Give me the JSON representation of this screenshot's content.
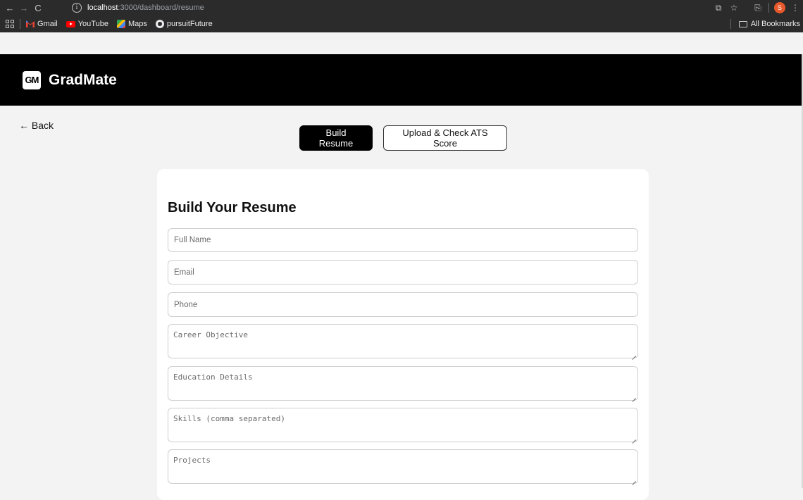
{
  "browser": {
    "url_host": "localhost",
    "url_path": ":3000/dashboard/resume",
    "bookmarks": [
      "Gmail",
      "YouTube",
      "Maps",
      "pursuitFuture"
    ],
    "all_bookmarks_label": "All Bookmarks",
    "profile_initial": "S"
  },
  "app": {
    "logo_text": "GM",
    "brand": "GradMate"
  },
  "page": {
    "back_label": "← Back",
    "tabs": [
      {
        "label": "Build Resume",
        "active": true
      },
      {
        "label": "Upload & Check ATS Score",
        "active": false
      }
    ]
  },
  "form": {
    "title": "Build Your Resume",
    "full_name_placeholder": "Full Name",
    "email_placeholder": "Email",
    "phone_placeholder": "Phone",
    "career_objective_placeholder": "Career Objective",
    "education_placeholder": "Education Details",
    "skills_placeholder": "Skills (comma separated)",
    "projects_placeholder": "Projects"
  }
}
